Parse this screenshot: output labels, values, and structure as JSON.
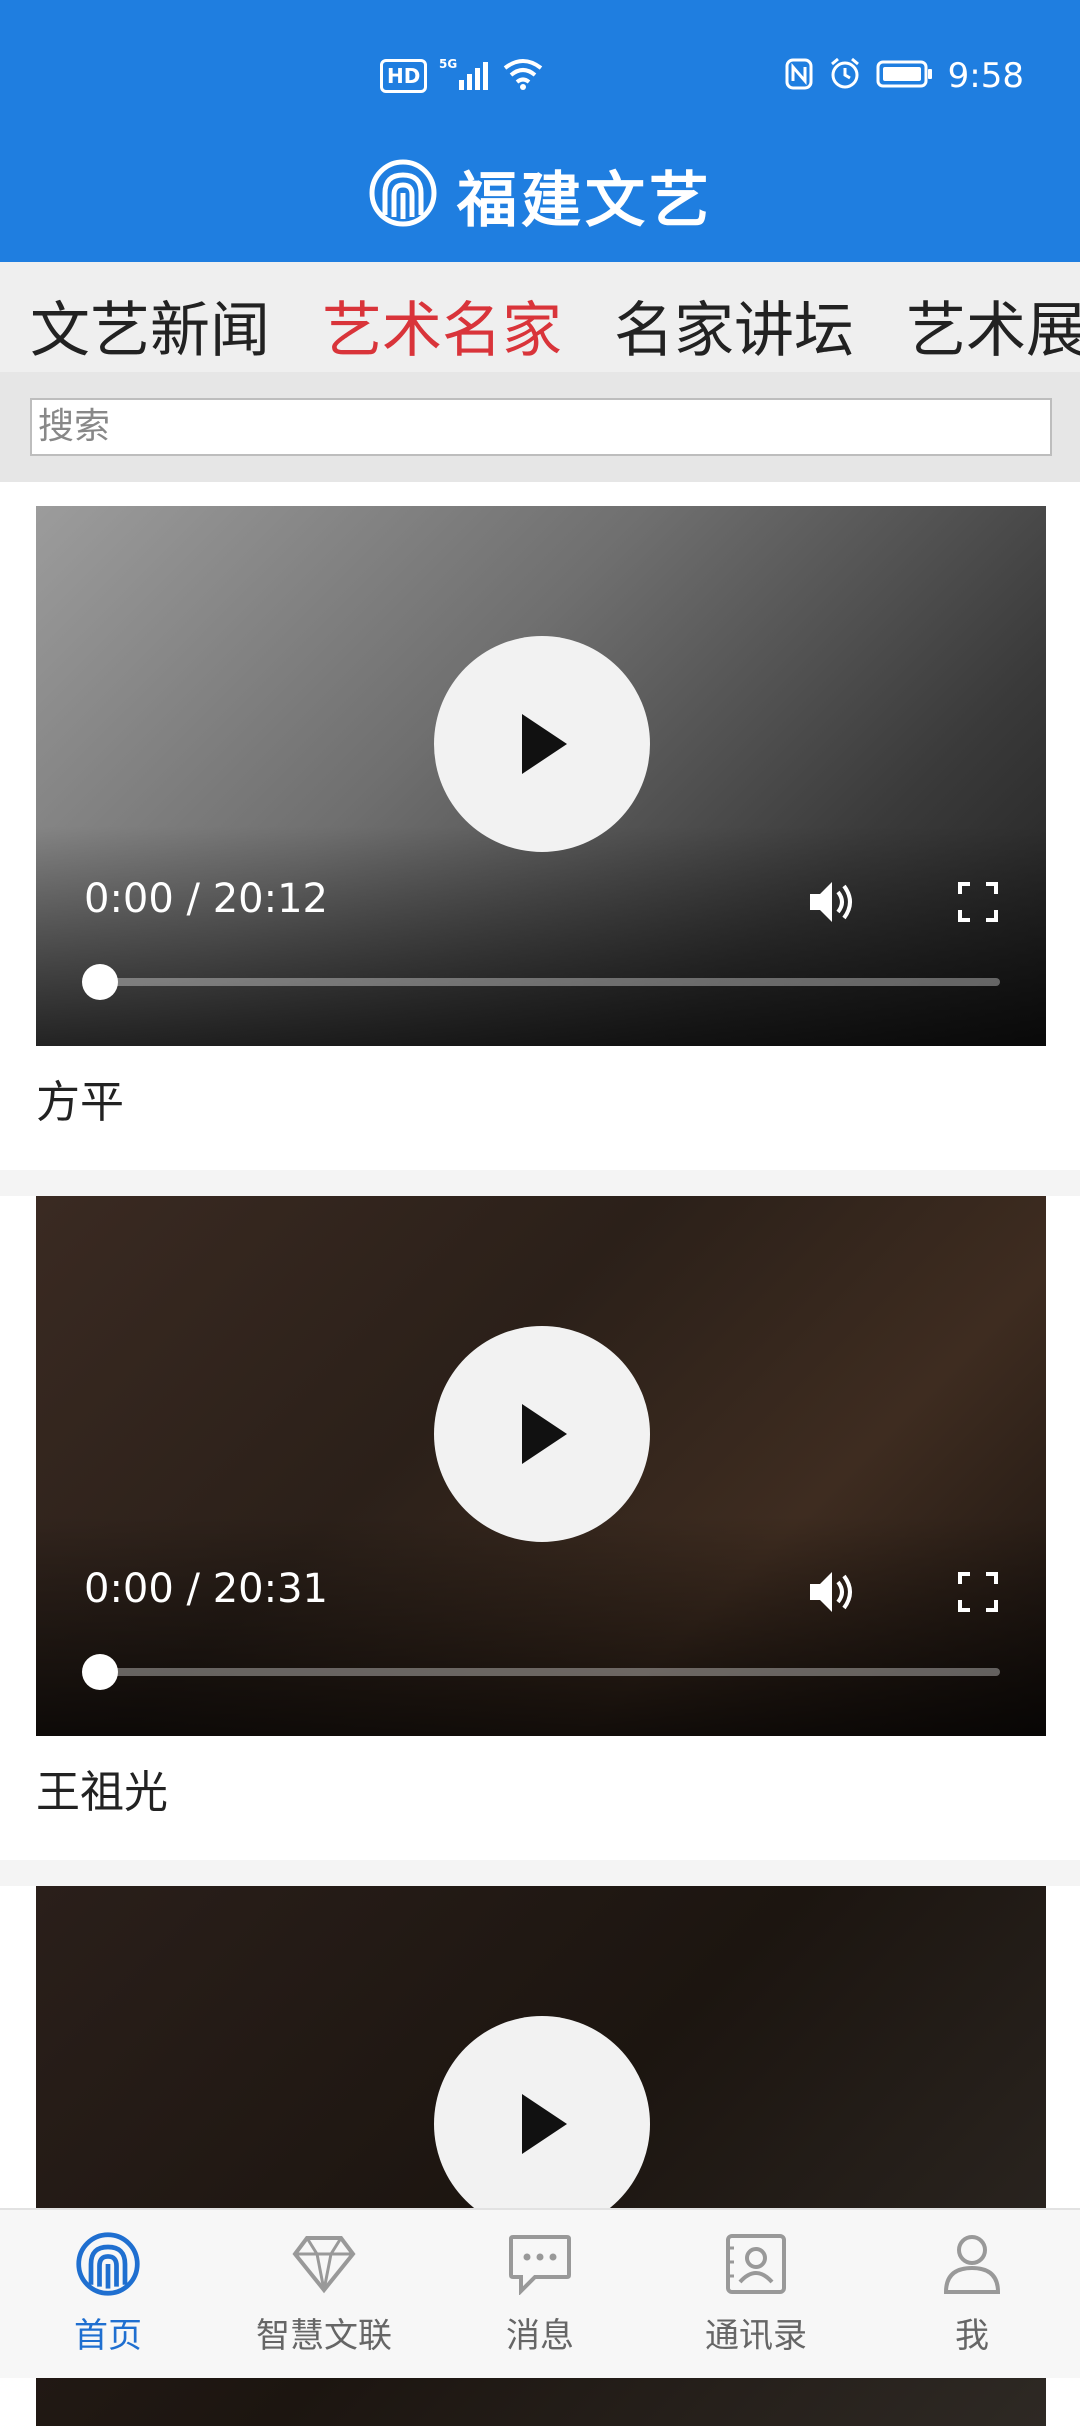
{
  "status_bar": {
    "network_badge": "HD",
    "network_type": "5G",
    "time": "9:58"
  },
  "header": {
    "title": "福建文艺"
  },
  "tabs": [
    {
      "label": "文艺新闻",
      "active": false
    },
    {
      "label": "艺术名家",
      "active": true
    },
    {
      "label": "名家讲坛",
      "active": false
    },
    {
      "label": "艺术展",
      "active": false
    }
  ],
  "search": {
    "placeholder": "搜索"
  },
  "feed": [
    {
      "time_display": "0:00 / 20:12",
      "progress": 0,
      "caption": "方平"
    },
    {
      "time_display": "0:00 / 20:31",
      "progress": 0,
      "caption": "王祖光"
    },
    {
      "time_display": "",
      "progress": 0,
      "caption": ""
    }
  ],
  "bottom_nav": [
    {
      "label": "首页",
      "icon": "home-logo-icon",
      "active": true
    },
    {
      "label": "智慧文联",
      "icon": "diamond-icon",
      "active": false
    },
    {
      "label": "消息",
      "icon": "chat-bubble-icon",
      "active": false
    },
    {
      "label": "通讯录",
      "icon": "contact-card-icon",
      "active": false
    },
    {
      "label": "我",
      "icon": "person-icon",
      "active": false
    }
  ],
  "colors": {
    "header_blue": "#1f7ee0",
    "active_tab": "#d9343a",
    "active_nav": "#1f6fd0"
  }
}
